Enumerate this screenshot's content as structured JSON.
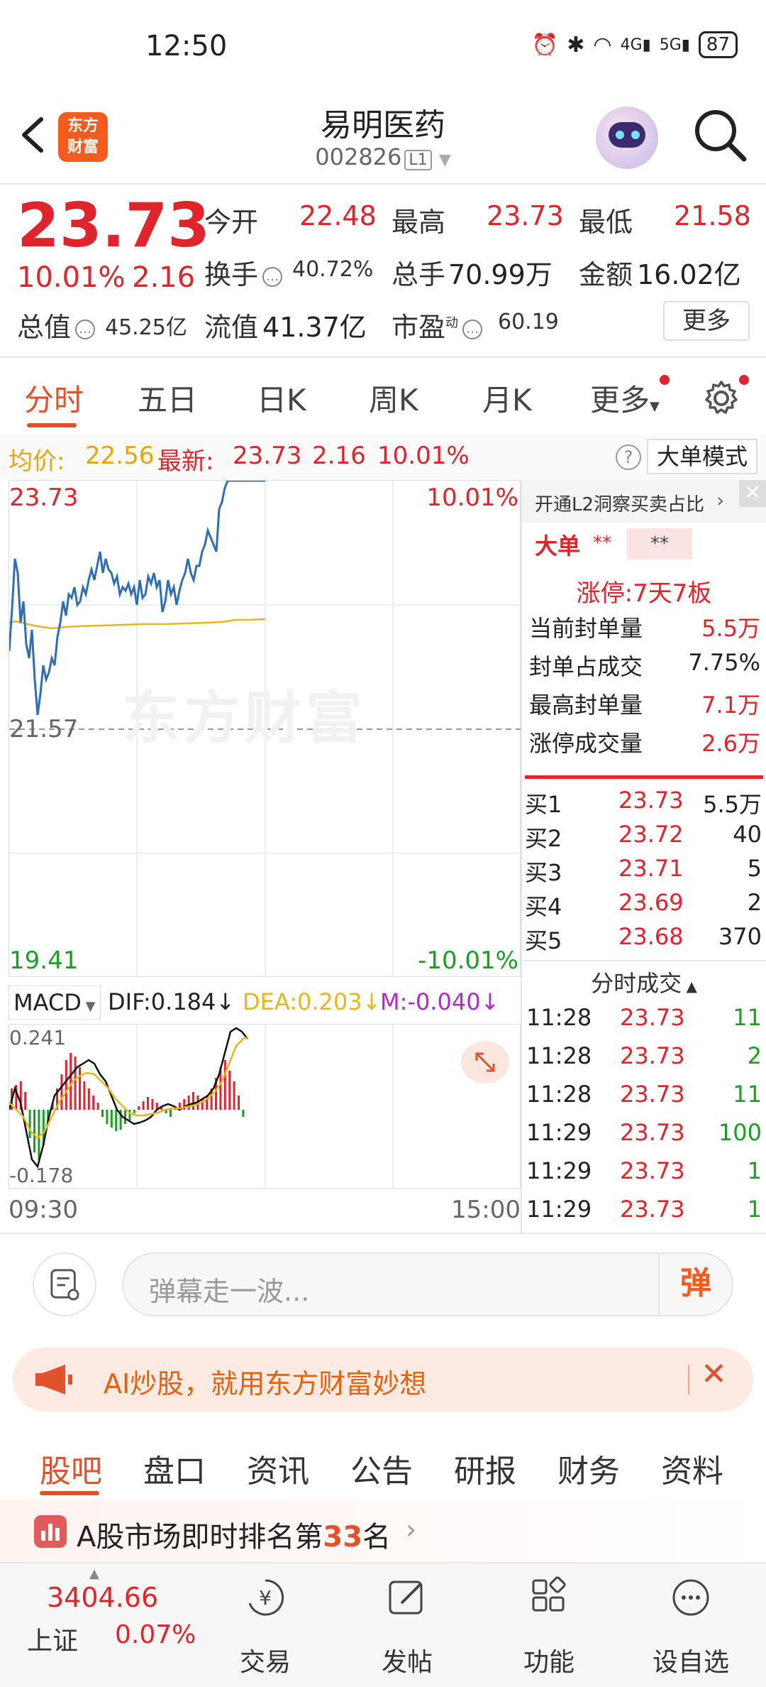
{
  "status_bar": {
    "time": "12:50",
    "battery": "87"
  },
  "header": {
    "logo_text": "东方\n财富",
    "stock_name": "易明医药",
    "stock_code": "002826",
    "level_badge": "L1"
  },
  "quote": {
    "price": "23.73",
    "change_pct": "10.01%",
    "change_amt": "2.16",
    "open_label": "今开",
    "open_value": "22.48",
    "high_label": "最高",
    "high_value": "23.73",
    "low_label": "最低",
    "low_value": "21.58",
    "turnover_label": "换手",
    "turnover_value": "40.72%",
    "volume_label": "总手",
    "volume_value": "70.99万",
    "amount_label": "金额",
    "amount_value": "16.02亿",
    "mktcap_label": "总值",
    "mktcap_value": "45.25亿",
    "float_label": "流值",
    "float_value": "41.37亿",
    "pe_label": "市盈",
    "pe_super": "动",
    "pe_value": "60.19",
    "more_button": "更多"
  },
  "chart_tabs": [
    "分时",
    "五日",
    "日K",
    "周K",
    "月K",
    "更多"
  ],
  "avg_bar": {
    "avg_label": "均价:",
    "avg_value": "22.56",
    "latest_label": "最新:",
    "latest_price": "23.73",
    "latest_chg": "2.16",
    "latest_pct": "10.01%",
    "big_order_mode": "大单模式"
  },
  "intraday_chart": {
    "y_top_left": "23.73",
    "y_top_right": "10.01%",
    "y_mid_left": "21.57",
    "y_bottom_left": "19.41",
    "y_bottom_right": "-10.01%",
    "watermark": "东方财富",
    "time_start": "09:30",
    "time_end": "15:00"
  },
  "macd": {
    "selector": "MACD",
    "dif": "DIF:0.184",
    "dea": "DEA:0.203",
    "m": "M:-0.040",
    "y_top": "0.241",
    "y_bottom": "-0.178"
  },
  "right_panel": {
    "l2_prompt": "开通L2洞察买卖占比",
    "big_order_label": "大单",
    "big_order_stars": "**",
    "big_order_box": "**",
    "limit_up_title": "涨停:7天7板",
    "seal_rows": [
      {
        "label": "当前封单量",
        "value": "5.5万"
      },
      {
        "label": "封单占成交",
        "value": "7.75%"
      },
      {
        "label": "最高封单量",
        "value": "7.1万"
      },
      {
        "label": "涨停成交量",
        "value": "2.6万"
      }
    ],
    "bids": [
      {
        "label": "买1",
        "price": "23.73",
        "vol": "5.5万"
      },
      {
        "label": "买2",
        "price": "23.72",
        "vol": "40"
      },
      {
        "label": "买3",
        "price": "23.71",
        "vol": "5"
      },
      {
        "label": "买4",
        "price": "23.69",
        "vol": "2"
      },
      {
        "label": "买5",
        "price": "23.68",
        "vol": "370"
      }
    ],
    "ticks_title": "分时成交",
    "ticks": [
      {
        "time": "11:28",
        "price": "23.73",
        "vol": "11",
        "vol_color": "#1a9e26"
      },
      {
        "time": "11:28",
        "price": "23.73",
        "vol": "2",
        "vol_color": "#1a9e26"
      },
      {
        "time": "11:28",
        "price": "23.73",
        "vol": "11",
        "vol_color": "#1a9e26"
      },
      {
        "time": "11:29",
        "price": "23.73",
        "vol": "100",
        "vol_color": "#1a9e26"
      },
      {
        "time": "11:29",
        "price": "23.73",
        "vol": "1",
        "vol_color": "#1a9e26"
      },
      {
        "time": "11:29",
        "price": "23.73",
        "vol": "1",
        "vol_color": "#1a9e26"
      }
    ]
  },
  "danmu": {
    "placeholder": "弹幕走一波...",
    "button": "弹"
  },
  "ai_banner": {
    "text": "AI炒股，就用东方财富妙想"
  },
  "bottom_tabs": [
    "股吧",
    "盘口",
    "资讯",
    "公告",
    "研报",
    "财务",
    "资料"
  ],
  "rank_banner": {
    "prefix": "A股市场即时排名第",
    "rank": "33",
    "suffix": "名"
  },
  "bottom_nav": {
    "index_value": "3404.66",
    "index_name": "上证",
    "index_pct": "0.07%",
    "items": [
      "交易",
      "发帖",
      "功能",
      "设自选"
    ]
  },
  "colors": {
    "up": "#e0242b",
    "down": "#1a9e26",
    "accent": "#e0522b",
    "price_line": "#2f6eb5",
    "avg_line": "#e8b521"
  }
}
